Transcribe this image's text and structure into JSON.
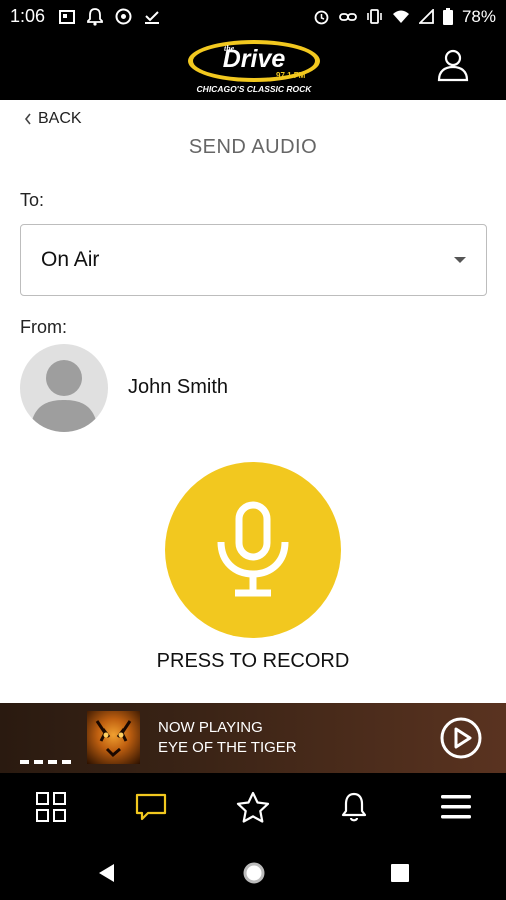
{
  "status_bar": {
    "time": "1:06",
    "battery_percent": "78%"
  },
  "header": {
    "logo_text": "Drive",
    "logo_prefix": "the",
    "logo_frequency": "97.1 FM",
    "logo_tagline": "CHICAGO'S CLASSIC ROCK"
  },
  "navigation": {
    "back_label": "BACK"
  },
  "page": {
    "title": "SEND AUDIO",
    "to_label": "To:",
    "recipient_value": "On Air",
    "from_label": "From:",
    "user_name": "John Smith",
    "record_label": "PRESS TO RECORD"
  },
  "now_playing": {
    "heading": "NOW PLAYING",
    "track": "EYE OF THE TIGER"
  },
  "colors": {
    "accent": "#f2c81f",
    "header_bg": "#000000"
  }
}
